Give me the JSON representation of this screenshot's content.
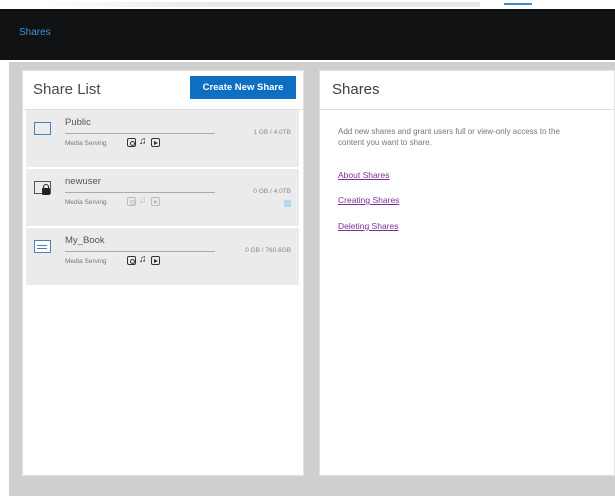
{
  "header": {
    "title": "Shares"
  },
  "left_panel": {
    "title": "Share List",
    "create_button": "Create New Share"
  },
  "shares": [
    {
      "name": "Public",
      "capacity": "1 GB / 4.0TB",
      "media_label": "Media Serving",
      "icon": "folder-icon",
      "media_enabled": true,
      "sync": false
    },
    {
      "name": "newuser",
      "capacity": "0 GB / 4.0TB",
      "media_label": "Media Serving",
      "icon": "user-lock-icon",
      "media_enabled": false,
      "sync": true
    },
    {
      "name": "My_Book",
      "capacity": "0 GB / 760.6GB",
      "media_label": "Media Serving",
      "icon": "drive-icon",
      "media_enabled": true,
      "sync": false
    }
  ],
  "right_panel": {
    "title": "Shares",
    "description": "Add new shares and grant users full or view-only access to the content you want to share.",
    "links": [
      "About Shares",
      "Creating Shares",
      "Deleting Shares"
    ]
  }
}
